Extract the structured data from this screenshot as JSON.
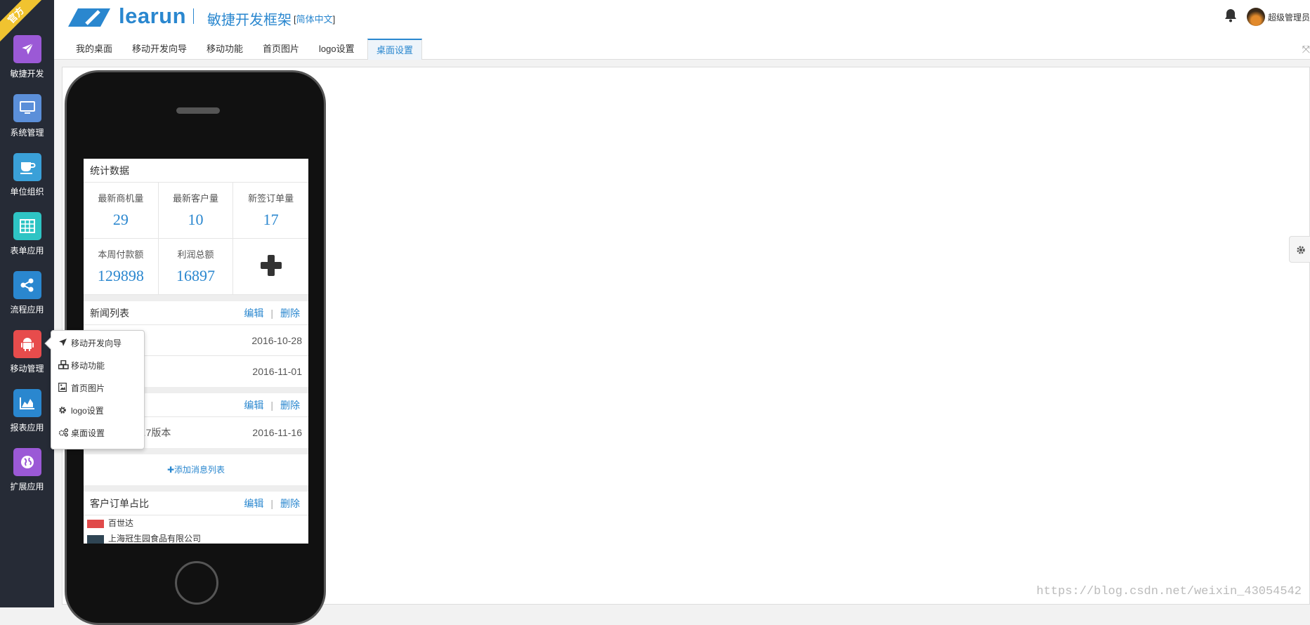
{
  "ribbon": "官方",
  "sidebar": {
    "items": [
      {
        "label": "敏捷开发",
        "icon": "paper-plane-icon",
        "color": "#9b59d6"
      },
      {
        "label": "系统管理",
        "icon": "monitor-icon",
        "color": "#5b8fd9"
      },
      {
        "label": "单位组织",
        "icon": "coffee-cup-icon",
        "color": "#3aa0d8"
      },
      {
        "label": "表单应用",
        "icon": "table-icon",
        "color": "#2ec4c4"
      },
      {
        "label": "流程应用",
        "icon": "share-icon",
        "color": "#2a87cf"
      },
      {
        "label": "移动管理",
        "icon": "android-icon",
        "color": "#e74c4c"
      },
      {
        "label": "报表应用",
        "icon": "area-chart-icon",
        "color": "#2a87cf"
      },
      {
        "label": "扩展应用",
        "icon": "globe-icon",
        "color": "#9b59d6"
      }
    ]
  },
  "header": {
    "logo_text": "learun",
    "slogan": "敏捷开发框架",
    "lang_open": "[",
    "lang": "简体中文",
    "lang_close": "]",
    "user_name": "超级管理员"
  },
  "tabs": [
    {
      "label": "我的桌面",
      "active": false
    },
    {
      "label": "移动开发向导",
      "active": false
    },
    {
      "label": "移动功能",
      "active": false
    },
    {
      "label": "首页图片",
      "active": false
    },
    {
      "label": "logo设置",
      "active": false
    },
    {
      "label": "桌面设置",
      "active": true
    }
  ],
  "phone": {
    "stats": {
      "title": "统计数据",
      "cells": [
        {
          "label": "最新商机量",
          "value": "29"
        },
        {
          "label": "最新客户量",
          "value": "10"
        },
        {
          "label": "新签订单量",
          "value": "17"
        },
        {
          "label": "本周付款额",
          "value": "129898"
        },
        {
          "label": "利润总额",
          "value": "16897"
        }
      ]
    },
    "news": {
      "title": "新闻列表",
      "edit": "编辑",
      "delete": "删除",
      "rows": [
        {
          "title": "",
          "date": "2016-10-28"
        },
        {
          "title": "",
          "date": "2016-11-01"
        }
      ]
    },
    "notice": {
      "title": "",
      "edit": "编辑",
      "delete": "删除",
      "rows": [
        {
          "title": ".1.7版本",
          "date": "2016-11-16"
        }
      ]
    },
    "add_list": "添加消息列表",
    "orders": {
      "title": "客户订单占比",
      "edit": "编辑",
      "delete": "删除",
      "legend": [
        {
          "name": "百世达",
          "color": "#e04a4a"
        },
        {
          "name": "上海冠生园食品有限公司",
          "color": "#2f4554"
        }
      ]
    }
  },
  "popup": {
    "items": [
      {
        "label": "移动开发向导",
        "icon": "paper-plane-icon"
      },
      {
        "label": "移动功能",
        "icon": "cubes-icon"
      },
      {
        "label": "首页图片",
        "icon": "image-icon"
      },
      {
        "label": "logo设置",
        "icon": "gear-icon"
      },
      {
        "label": "桌面设置",
        "icon": "gears-icon"
      }
    ]
  },
  "watermark": "https://blog.csdn.net/weixin_43054542",
  "colors": {
    "accent": "#2a87cf",
    "sidebar_bg": "#262b36",
    "ribbon": "#f0c330"
  }
}
